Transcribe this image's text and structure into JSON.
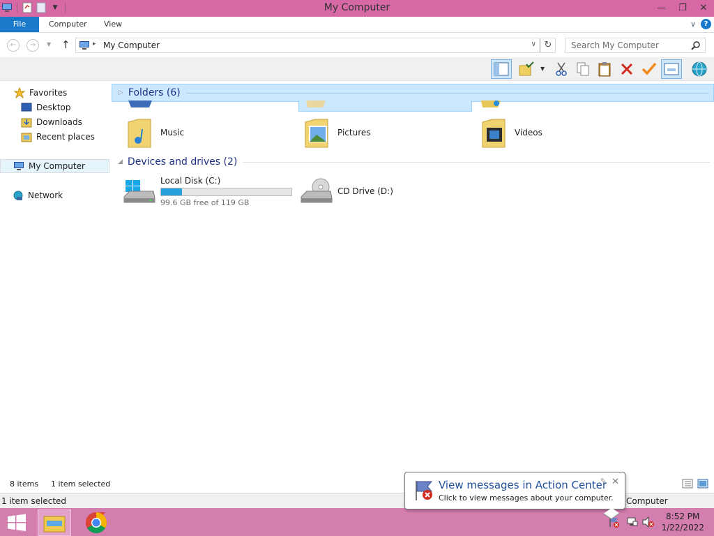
{
  "window": {
    "title": "My Computer"
  },
  "ribbon": {
    "tabs": [
      "File",
      "Computer",
      "View"
    ]
  },
  "address": {
    "path": "My Computer",
    "search_placeholder": "Search My Computer"
  },
  "nav": {
    "favorites": "Favorites",
    "items": [
      "Desktop",
      "Downloads",
      "Recent places"
    ],
    "computer": "My Computer",
    "network": "Network"
  },
  "content": {
    "folders_header": "Folders (6)",
    "folders": [
      "Music",
      "Pictures",
      "Videos"
    ],
    "devices_header": "Devices and drives (2)",
    "drives": [
      {
        "name": "Local Disk (C:)",
        "free": "99.6 GB free of 119 GB",
        "used_fraction": 0.163
      },
      {
        "name": "CD Drive (D:)"
      }
    ]
  },
  "status": {
    "items": "8 items",
    "selected": "1 item selected",
    "bottom_selected": "1 item selected",
    "bottom_right": "Computer"
  },
  "notification": {
    "title": "View messages in Action Center",
    "body": "Click to view messages about your computer."
  },
  "clock": {
    "time": "8:52 PM",
    "date": "1/22/2022"
  },
  "colors": {
    "titlebar": "#d668a6",
    "taskbar": "#d47eb0",
    "file_tab": "#1979ca",
    "drive_bar": "#26a0da"
  }
}
